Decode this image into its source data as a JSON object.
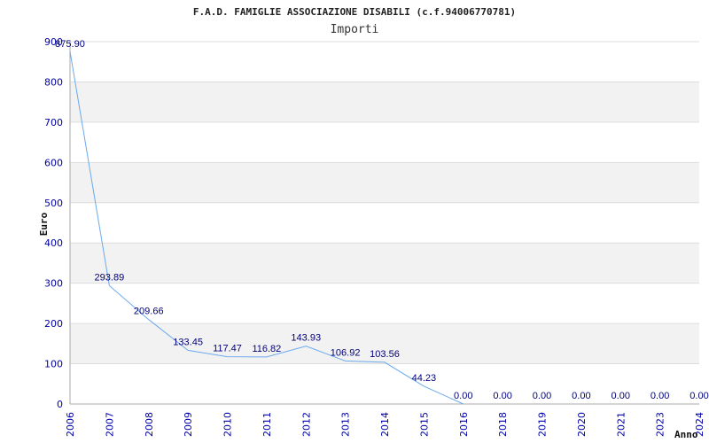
{
  "chart_data": {
    "type": "line",
    "title": "F.A.D. FAMIGLIE ASSOCIAZIONE DISABILI (c.f.94006770781)",
    "subtitle": "Importi",
    "xlabel": "Anno",
    "ylabel": "Euro",
    "ylim": [
      0,
      900
    ],
    "yticks": [
      "0",
      "100",
      "200",
      "300",
      "400",
      "500",
      "600",
      "700",
      "800",
      "900"
    ],
    "categories": [
      "2006",
      "2007",
      "2008",
      "2009",
      "2010",
      "2011",
      "2012",
      "2013",
      "2014",
      "2015",
      "2016",
      "2018",
      "2019",
      "2020",
      "2021",
      "2023",
      "2024"
    ],
    "values": [
      875.9,
      293.89,
      209.66,
      133.45,
      117.47,
      116.82,
      143.93,
      106.92,
      103.56,
      44.23,
      0.0,
      0.0,
      0.0,
      0.0,
      0.0,
      0.0,
      0.0
    ],
    "value_labels": [
      "875.90",
      "293.89",
      "209.66",
      "133.45",
      "117.47",
      "116.82",
      "143.93",
      "106.92",
      "103.56",
      "44.23",
      "0.00",
      "0.00",
      "0.00",
      "0.00",
      "0.00",
      "0.00",
      "0.00"
    ],
    "line_segments_drawn": 10,
    "grid": true,
    "colors": {
      "line": "#6aa9ee",
      "band": "#f2f2f2",
      "grid": "#dddddd",
      "tick_text": "#0000aa",
      "label_text": "#00007a",
      "axis": "#aaaaaa"
    }
  }
}
